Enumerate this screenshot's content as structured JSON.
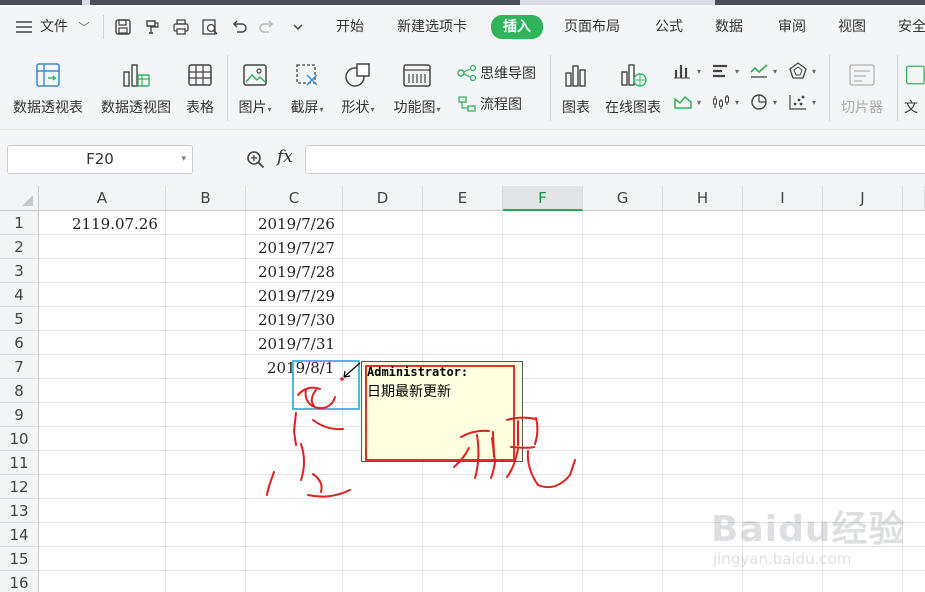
{
  "menubar": {
    "file_label": "文件",
    "tabs": [
      "开始",
      "新建选项卡",
      "插入",
      "页面布局",
      "公式",
      "数据",
      "审阅",
      "视图",
      "安全"
    ],
    "active_tab": "插入"
  },
  "ribbon": {
    "pivot_table": "数据透视表",
    "pivot_chart": "数据透视图",
    "table": "表格",
    "picture": "图片",
    "screenshot": "截屏",
    "shapes": "形状",
    "function_chart": "功能图",
    "mind_map": "思维导图",
    "flowchart": "流程图",
    "chart": "图表",
    "online_chart": "在线图表",
    "slicer": "切片器",
    "text_partial": "文"
  },
  "formula_bar": {
    "name_box": "F20",
    "fx_label": "fx",
    "formula": ""
  },
  "sheet": {
    "columns": [
      "A",
      "B",
      "C",
      "D",
      "E",
      "F",
      "G",
      "H",
      "I",
      "J"
    ],
    "selected_column": "F",
    "rows": [
      "1",
      "2",
      "3",
      "4",
      "5",
      "6",
      "7",
      "8",
      "9",
      "10",
      "11",
      "12",
      "13",
      "14",
      "15",
      "16"
    ],
    "cells": {
      "A1": "2119.07.26",
      "C1": "2019/7/26",
      "C2": "2019/7/27",
      "C3": "2019/7/28",
      "C4": "2019/7/29",
      "C5": "2019/7/30",
      "C6": "2019/7/31",
      "C7": "2019/8/1"
    }
  },
  "comment": {
    "author": "Administrator:",
    "text": "日期最新更新"
  },
  "watermark": {
    "logo": "Baidu经验",
    "url": "jingyan.baidu.com"
  },
  "colors": {
    "accent_green": "#2fb35b",
    "annotation_red": "#e02020",
    "comment_bg": "#ffffe1"
  }
}
